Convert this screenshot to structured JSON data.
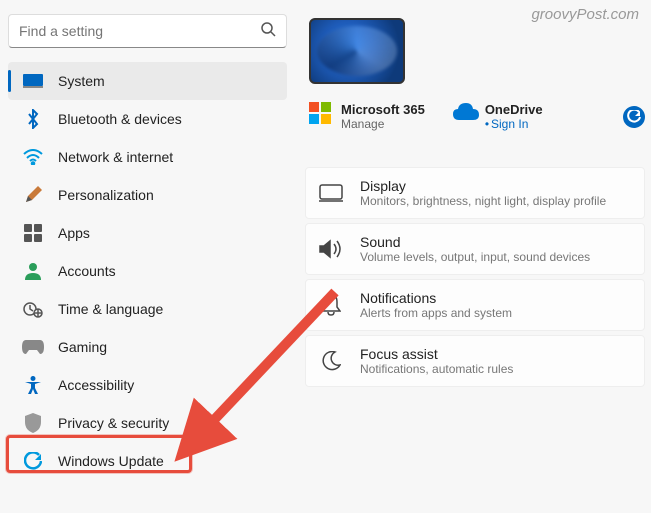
{
  "watermark": "groovyPost.com",
  "search": {
    "placeholder": "Find a setting"
  },
  "sidebar": {
    "items": [
      {
        "label": "System",
        "icon": "system-icon"
      },
      {
        "label": "Bluetooth & devices",
        "icon": "bluetooth-icon"
      },
      {
        "label": "Network & internet",
        "icon": "wifi-icon"
      },
      {
        "label": "Personalization",
        "icon": "brush-icon"
      },
      {
        "label": "Apps",
        "icon": "apps-icon"
      },
      {
        "label": "Accounts",
        "icon": "person-icon"
      },
      {
        "label": "Time & language",
        "icon": "clock-globe-icon"
      },
      {
        "label": "Gaming",
        "icon": "gamepad-icon"
      },
      {
        "label": "Accessibility",
        "icon": "accessibility-icon"
      },
      {
        "label": "Privacy & security",
        "icon": "shield-icon"
      },
      {
        "label": "Windows Update",
        "icon": "update-icon"
      }
    ],
    "active_index": 0,
    "highlighted_index": 9
  },
  "accounts": {
    "ms365": {
      "title": "Microsoft 365",
      "sub": "Manage"
    },
    "onedrive": {
      "title": "OneDrive",
      "sub": "Sign In"
    }
  },
  "cards": [
    {
      "title": "Display",
      "desc": "Monitors, brightness, night light, display profile",
      "icon": "display-icon"
    },
    {
      "title": "Sound",
      "desc": "Volume levels, output, input, sound devices",
      "icon": "sound-icon"
    },
    {
      "title": "Notifications",
      "desc": "Alerts from apps and system",
      "icon": "bell-icon"
    },
    {
      "title": "Focus assist",
      "desc": "Notifications, automatic rules",
      "icon": "moon-icon"
    }
  ]
}
